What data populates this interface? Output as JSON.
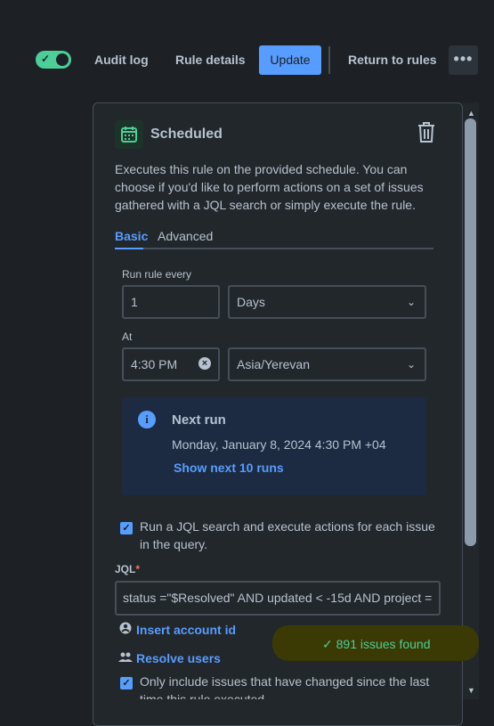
{
  "topbar": {
    "audit_log": "Audit log",
    "rule_details": "Rule details",
    "update": "Update",
    "return_to_rules": "Return to rules",
    "more": "•••"
  },
  "trigger": {
    "title": "Scheduled",
    "description": "Executes this rule on the provided schedule. You can choose if you'd like to perform actions on a set of issues gathered with a JQL search or simply execute the rule.",
    "tabs": [
      "Basic",
      "Advanced"
    ],
    "active_tab": "Basic",
    "run_rule_every_label": "Run rule every",
    "interval_value": "1",
    "interval_unit": "Days",
    "at_label": "At",
    "time_value": "4:30 PM",
    "timezone": "Asia/Yerevan",
    "next_run": {
      "title": "Next run",
      "date": "Monday, January 8, 2024 4:30 PM +04",
      "show_next": "Show next 10 runs"
    },
    "jql_checkbox_label": "Run a JQL search and execute actions for each issue in the query.",
    "jql_checked": true,
    "jql_label": "JQL",
    "jql_required_mark": "*",
    "jql_value": "status =\"$Resolved\" AND updated < -15d AND project =",
    "insert_account_id": "Insert account id",
    "resolve_users": "Resolve users",
    "issues_found": "891 issues found",
    "only_changed_label": "Only include issues that have changed since the last time this rule executed",
    "only_changed_checked": true
  },
  "colors": {
    "accent": "#579dff",
    "success": "#4bce97",
    "background": "#1d2125",
    "panel": "#22272b"
  }
}
